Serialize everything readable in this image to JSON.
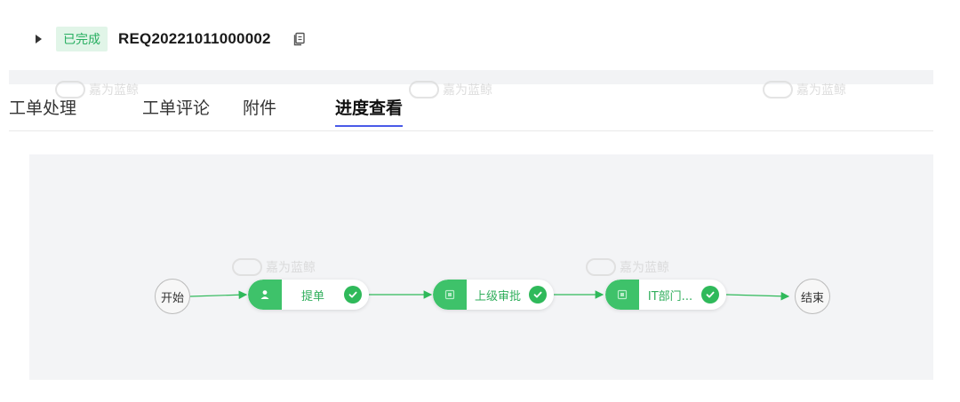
{
  "header": {
    "status_badge": "已完成",
    "request_id": "REQ20221011000002"
  },
  "tabs": [
    {
      "label": "工单处理"
    },
    {
      "label": "工单评论"
    },
    {
      "label": "附件"
    },
    {
      "label": "进度查看"
    }
  ],
  "active_tab": "进度查看",
  "watermark": "嘉为蓝鲸",
  "flow": {
    "start_label": "开始",
    "end_label": "结束",
    "nodes": [
      {
        "label": "提单",
        "icon": "user-icon",
        "status": "completed"
      },
      {
        "label": "上级审批",
        "icon": "approval-icon",
        "status": "completed"
      },
      {
        "label": "IT部门...",
        "icon": "approval-icon",
        "status": "completed"
      }
    ]
  },
  "colors": {
    "accent_green": "#2fb95a",
    "tab_underline": "#4a5ae8",
    "badge_bg": "#e1f5e8",
    "canvas_bg": "#f3f4f6"
  }
}
